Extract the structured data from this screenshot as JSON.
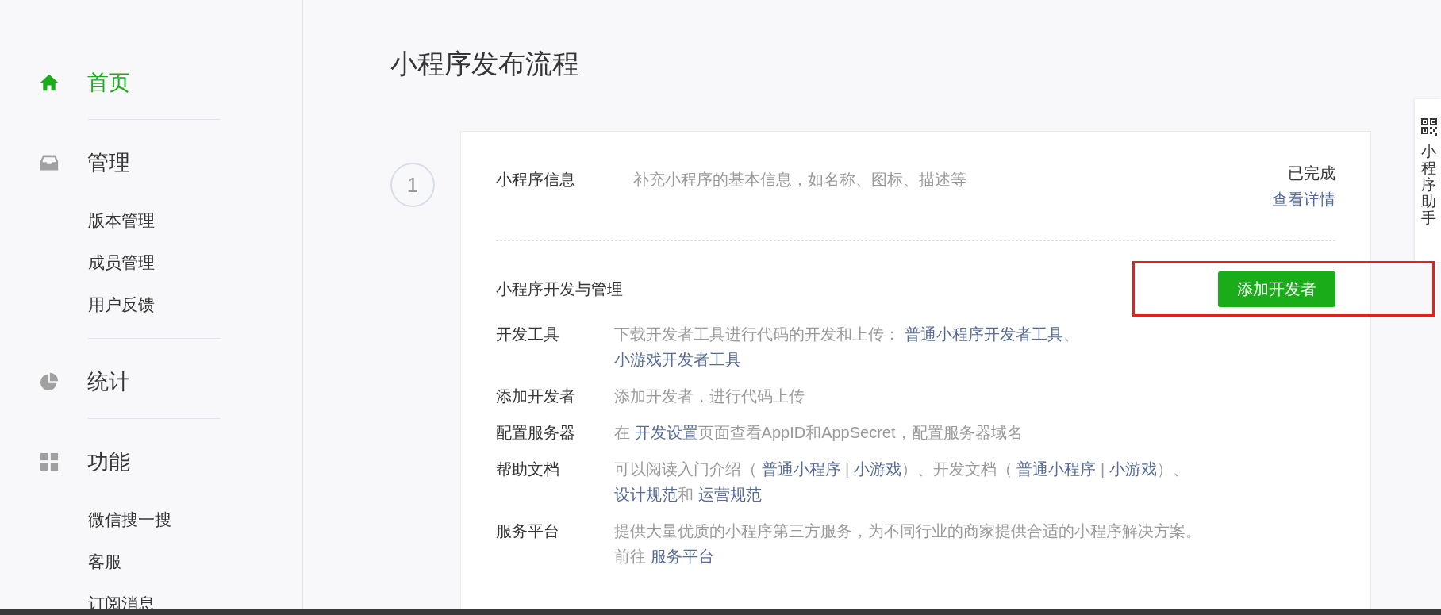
{
  "sidebar": {
    "sections": [
      {
        "label": "首页",
        "selected": true
      },
      {
        "label": "管理",
        "selected": false,
        "items": [
          {
            "label": "版本管理",
            "selected": false
          },
          {
            "label": "成员管理",
            "selected": false
          },
          {
            "label": "用户反馈",
            "selected": false
          }
        ]
      },
      {
        "label": "统计",
        "selected": false
      },
      {
        "label": "功能",
        "selected": false,
        "items": [
          {
            "label": "微信搜一搜",
            "selected": false
          },
          {
            "label": "客服",
            "selected": false
          },
          {
            "label": "订阅消息",
            "selected": false
          }
        ]
      }
    ]
  },
  "page_title": "小程序发布流程",
  "steps": [
    {
      "number": "1",
      "info": {
        "title": "小程序信息",
        "description": "补充小程序的基本信息，如名称、图标、描述等",
        "status": "已完成",
        "link": "查看详情"
      },
      "dev": {
        "title": "小程序开发与管理",
        "button": "添加开发者",
        "highlighted": true,
        "rows": [
          {
            "label": "开发工具",
            "segments": [
              {
                "kind": "text",
                "text": "下载开发者工具进行代码的开发和上传： "
              },
              {
                "kind": "link",
                "text": "普通小程序开发者工具"
              },
              {
                "kind": "text",
                "text": "、 "
              },
              {
                "kind": "link",
                "text": "小游戏开发者工具"
              }
            ]
          },
          {
            "label": "添加开发者",
            "segments": [
              {
                "kind": "text",
                "text": "添加开发者，进行代码上传"
              }
            ]
          },
          {
            "label": "配置服务器",
            "segments": [
              {
                "kind": "text",
                "text": "在 "
              },
              {
                "kind": "link",
                "text": "开发设置"
              },
              {
                "kind": "text",
                "text": "页面查看AppID和AppSecret，配置服务器域名"
              }
            ]
          },
          {
            "label": "帮助文档",
            "segments": [
              {
                "kind": "text",
                "text": "可以阅读入门介绍（ "
              },
              {
                "kind": "link",
                "text": "普通小程序"
              },
              {
                "kind": "text",
                "text": " | "
              },
              {
                "kind": "link",
                "text": "小游戏"
              },
              {
                "kind": "text",
                "text": "）、开发文档（ "
              },
              {
                "kind": "link",
                "text": "普通小程序"
              },
              {
                "kind": "text",
                "text": " | "
              },
              {
                "kind": "link",
                "text": "小游戏"
              },
              {
                "kind": "text",
                "text": "）、 "
              },
              {
                "kind": "link",
                "text": "设计规范"
              },
              {
                "kind": "text",
                "text": "和 "
              },
              {
                "kind": "link",
                "text": "运营规范"
              }
            ]
          },
          {
            "label": "服务平台",
            "segments": [
              {
                "kind": "text",
                "text": "提供大量优质的小程序第三方服务，为不同行业的商家提供合适的小程序解决方案。前往 "
              },
              {
                "kind": "link",
                "text": "服务平台"
              }
            ]
          }
        ]
      }
    }
  ],
  "side_panel": {
    "label": "小程序助手"
  }
}
